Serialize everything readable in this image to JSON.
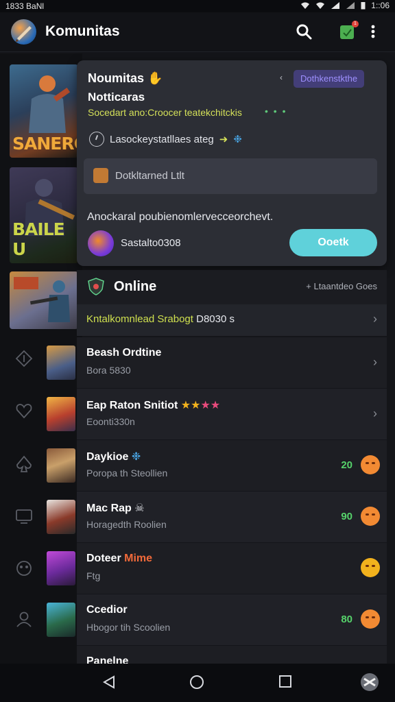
{
  "status_bar": {
    "left_text": "1833 BaNl",
    "time": "1::06"
  },
  "app_bar": {
    "title": "Komunitas",
    "notification_count": "1"
  },
  "left_banners": [
    {
      "word": "SANERG"
    },
    {
      "word": "BAILE U"
    }
  ],
  "notification_card": {
    "title": "Noumitas",
    "subtitle": "Notticaras",
    "tag_line": "Socedart ano:Croocer teatekchitckis",
    "pill_label": "Dothkenstkthe",
    "timer_text": "Lasockeystatllaes ateg",
    "box_label": "Dotkltarned Ltlt",
    "description": "Anockaral poubienomlervecceorchevt.",
    "user_id": "Sastalto0308",
    "check_button": "Ooetk"
  },
  "online_section": {
    "heading": "Online",
    "right_text": "+ Ltaantdeo Goes",
    "filter_highlight": "Kntalkomnlead Srabogt",
    "filter_plain": "D8030 s"
  },
  "online_list": [
    {
      "name": "Beash Ordtine",
      "sub": "Bora 5830",
      "trail": "chevron"
    },
    {
      "name": "Eap Raton Snitiot",
      "sub": "Eoonti330n",
      "trail": "chevron",
      "stars": "★★",
      "stars_pink": "★★"
    },
    {
      "name": "Daykioe",
      "sub": "Poropa th Steollien",
      "score": "20",
      "emoji": "orange"
    },
    {
      "name": "Mac Rap",
      "sub": "Horagedth Roolien",
      "score": "90",
      "emoji": "orange"
    },
    {
      "name": "Doteer",
      "name_accent": "Mime",
      "sub": "Ftg",
      "emoji": "gold"
    },
    {
      "name": "Ccedior",
      "sub": "Hbogor tih Scoolien",
      "score": "80",
      "emoji": "orange"
    },
    {
      "name": "Panelne",
      "sub": ""
    }
  ],
  "colors": {
    "background": "#141519",
    "card": "#2c2e35",
    "accent_teal": "#5fd1da",
    "accent_lime": "#cfe04f",
    "score_green": "#56d36b",
    "pill_purple": "#433e78"
  }
}
